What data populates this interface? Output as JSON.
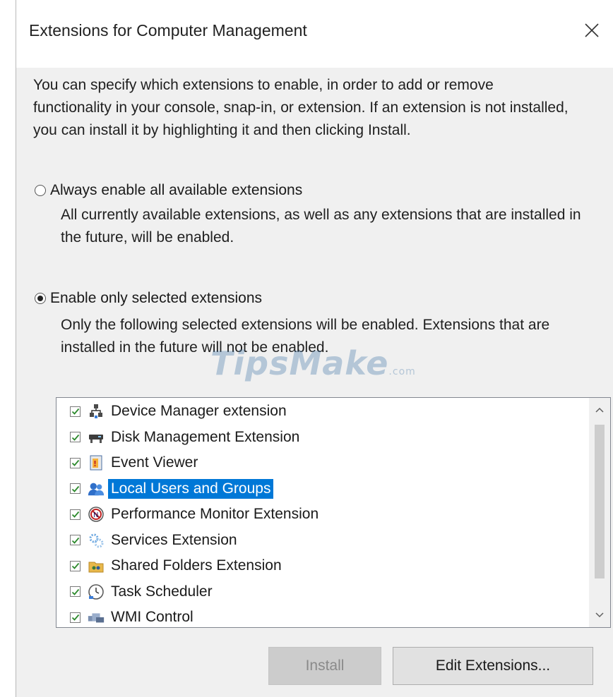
{
  "dialog": {
    "title": "Extensions for Computer Management",
    "description": "You can specify which extensions to enable, in order to add or remove functionality in your console, snap-in, or extension. If an extension is not installed, you can install it by highlighting it and then clicking Install."
  },
  "options": {
    "always": {
      "label": "Always enable all available extensions",
      "description": "All currently available extensions, as well as any extensions that are installed in the future, will be enabled.",
      "selected": false
    },
    "selected_only": {
      "label": "Enable only selected extensions",
      "description": "Only the following selected extensions will be enabled. Extensions that are installed in the future will not be enabled.",
      "selected": true
    }
  },
  "watermark": {
    "text": "TipsMake",
    "suffix": ".com"
  },
  "extensions": [
    {
      "label": "Device Manager extension",
      "checked": true,
      "icon": "device-manager-icon"
    },
    {
      "label": "Disk Management Extension",
      "checked": true,
      "icon": "disk-management-icon"
    },
    {
      "label": "Event Viewer",
      "checked": true,
      "icon": "event-viewer-icon"
    },
    {
      "label": "Local Users and Groups",
      "checked": true,
      "icon": "users-groups-icon",
      "selected": true
    },
    {
      "label": "Performance Monitor Extension",
      "checked": true,
      "icon": "performance-monitor-icon"
    },
    {
      "label": "Services Extension",
      "checked": true,
      "icon": "services-gear-icon"
    },
    {
      "label": "Shared Folders Extension",
      "checked": true,
      "icon": "shared-folder-icon"
    },
    {
      "label": "Task Scheduler",
      "checked": true,
      "icon": "clock-icon"
    },
    {
      "label": "WMI Control",
      "checked": true,
      "icon": "wmi-control-icon"
    }
  ],
  "buttons": {
    "install": "Install",
    "edit_extensions": "Edit Extensions..."
  },
  "colors": {
    "selection": "#0078d7",
    "checkmark": "#2d8a2d",
    "dialog_bg": "#f0f0f0"
  }
}
